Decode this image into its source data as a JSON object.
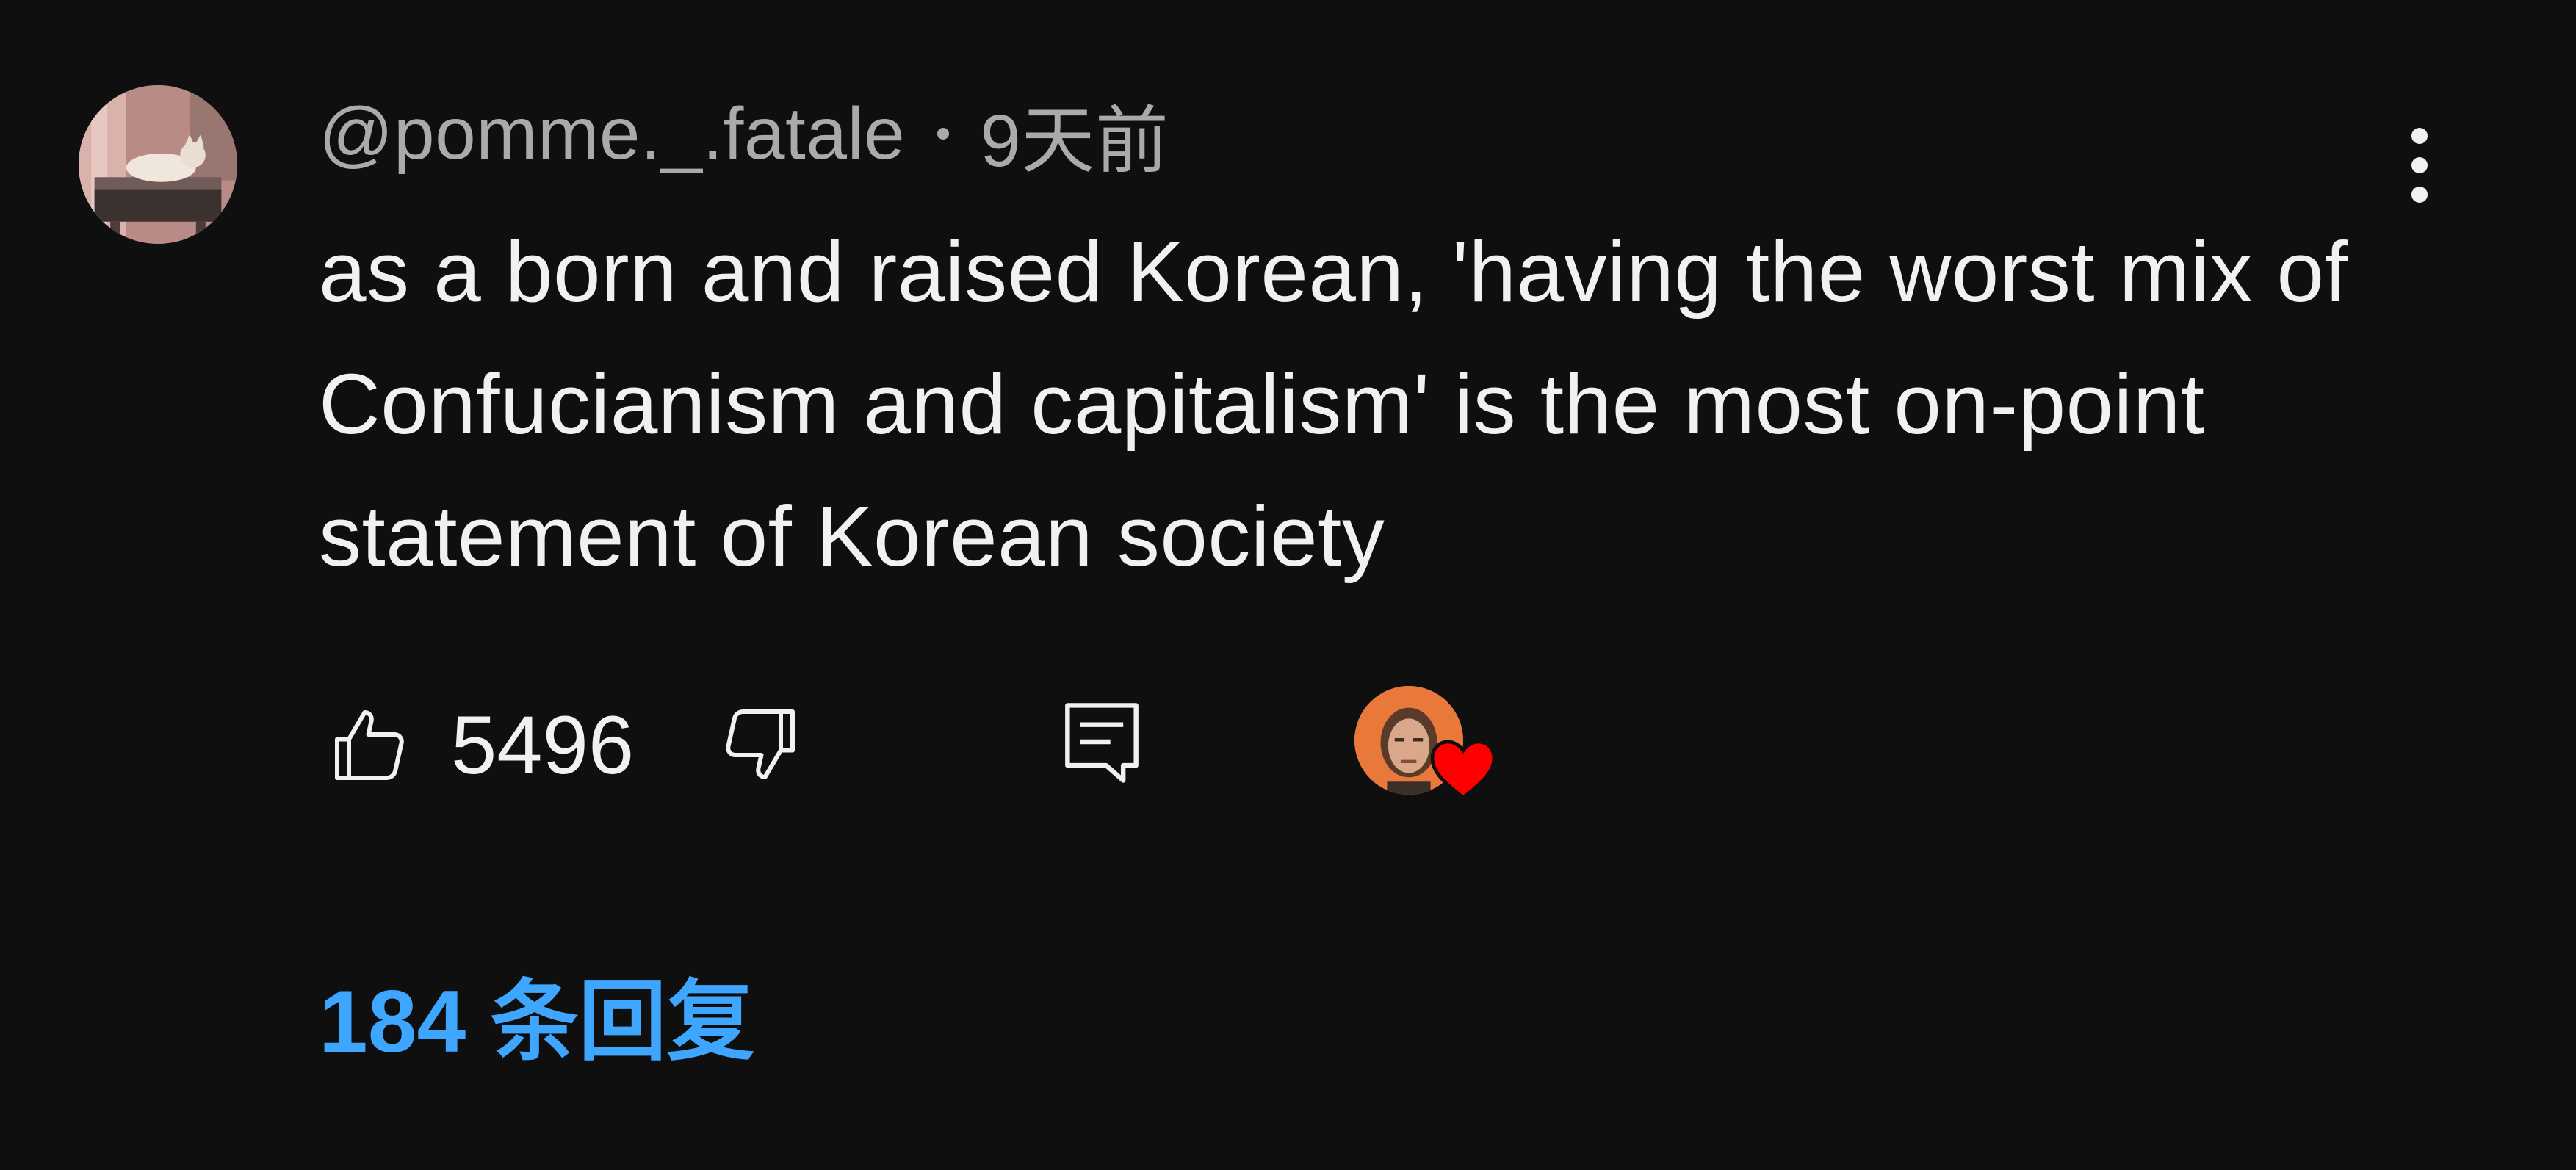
{
  "comment": {
    "author": "@pomme._.fatale",
    "timestamp": "9天前",
    "text": "as a born and raised Korean, 'having the worst mix of Confucianism and capitalism' is the most on-point statement of Korean society",
    "avatar_icon": "cat-on-bed-avatar"
  },
  "actions": {
    "like_icon": "thumbs-up-icon",
    "like_count": "5496",
    "dislike_icon": "thumbs-down-icon",
    "reply_icon": "reply-comment-icon",
    "creator_heart_icon": "heart-icon",
    "heart_color": "#ff0000",
    "creator_avatar_color": "#e8793a"
  },
  "replies": {
    "label": "184 条回复",
    "color": "#3ea6ff"
  },
  "menu": {
    "icon": "more-vertical-icon"
  },
  "colors": {
    "background": "#0f0f0f",
    "primary_text": "#f1f1f1",
    "secondary_text": "#aaaaaa"
  }
}
